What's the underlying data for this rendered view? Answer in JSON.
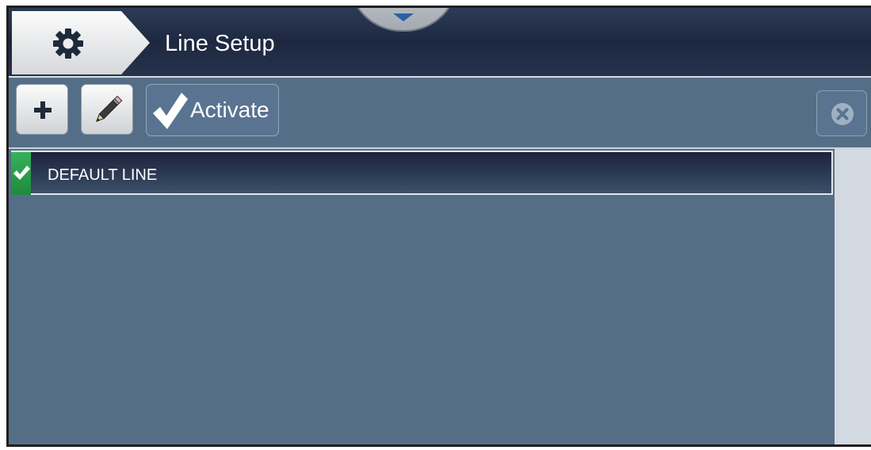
{
  "header": {
    "title": "Line Setup",
    "home_icon": "gear-icon",
    "pulldown_icon": "chevron-down-icon"
  },
  "toolbar": {
    "add_icon": "plus-icon",
    "edit_icon": "pencil-icon",
    "activate_label": "Activate",
    "activate_icon": "checkmark-icon",
    "close_icon": "close-icon"
  },
  "lines": {
    "items": [
      {
        "label": "DEFAULT LINE",
        "active": true
      }
    ]
  },
  "colors": {
    "header_bg": "#1d2840",
    "panel_bg": "#556e88",
    "active_green": "#2fa552",
    "scrollbar": "#d3d9e0"
  }
}
